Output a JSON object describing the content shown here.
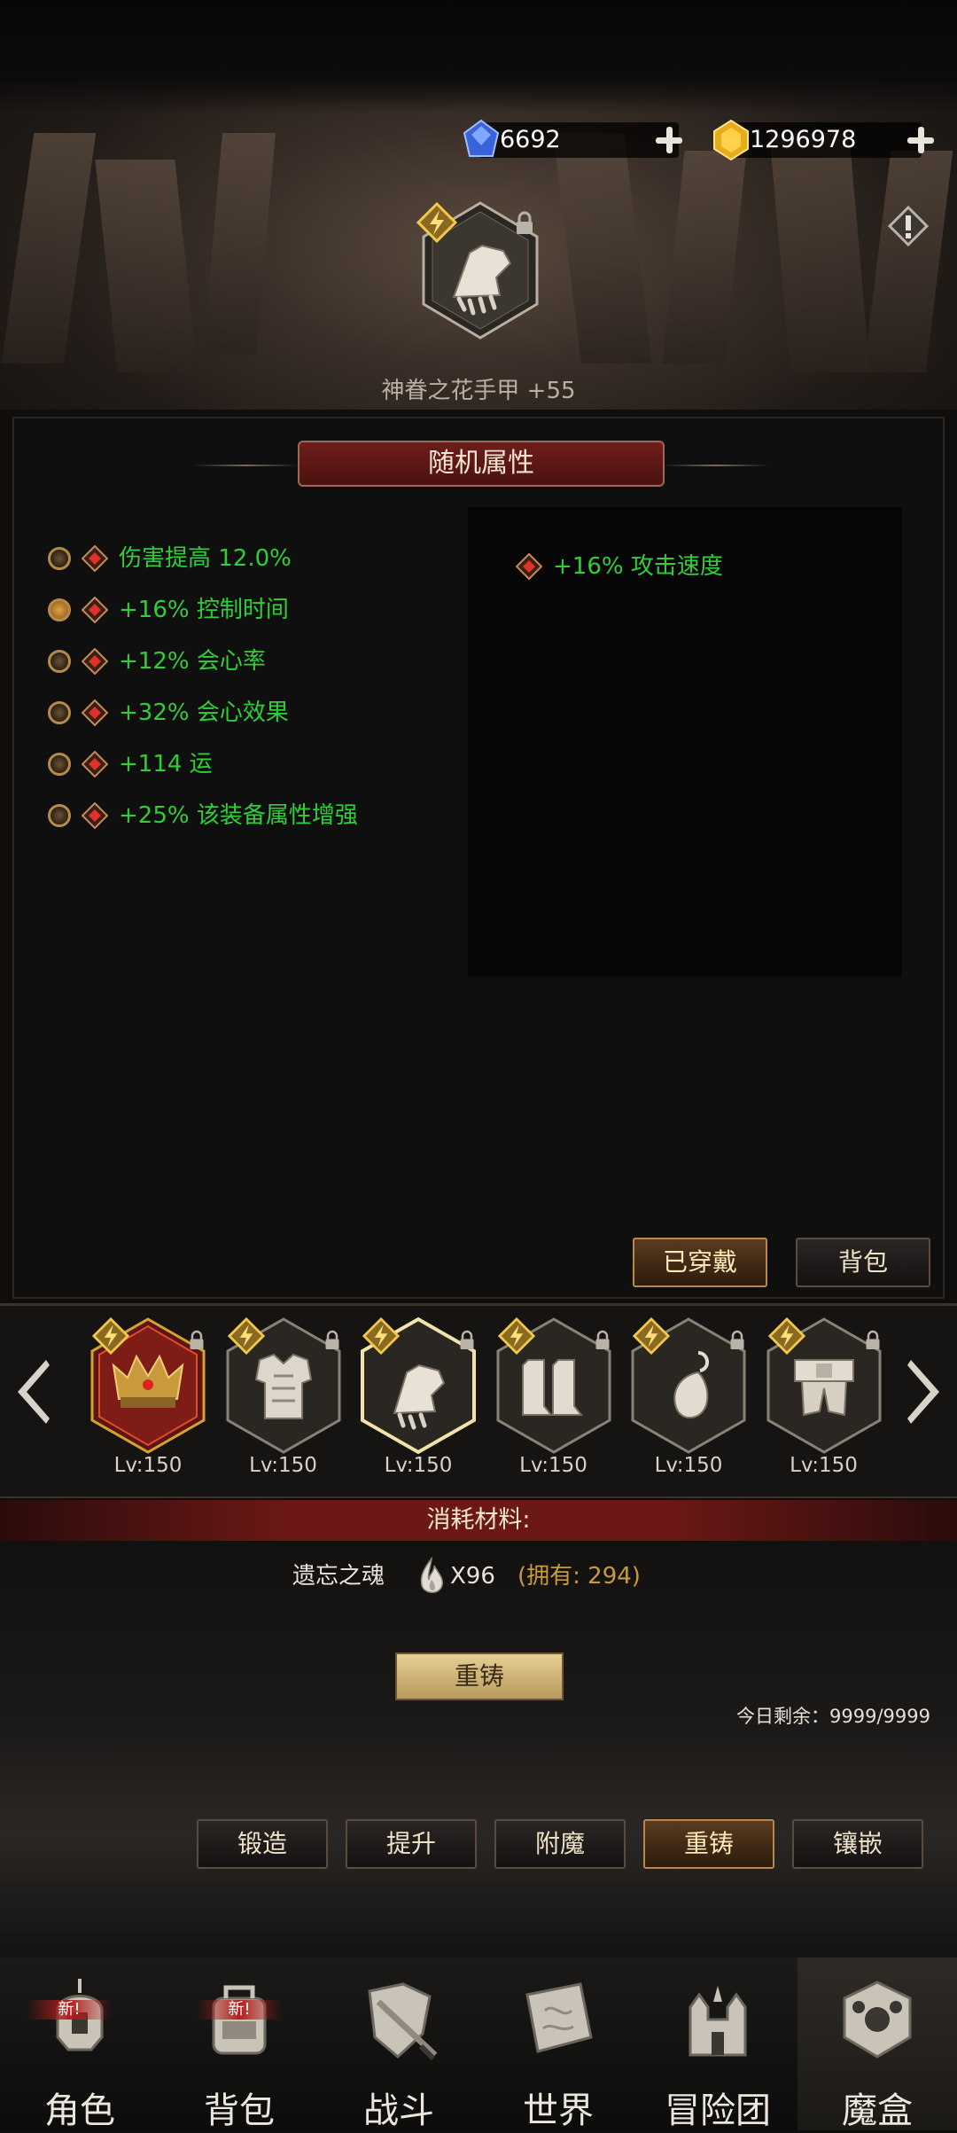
{
  "currency": {
    "gems": "6692",
    "gold": "1296978"
  },
  "item": {
    "name": "神眷之花手甲 +55"
  },
  "panel": {
    "title": "随机属性",
    "attributes": [
      {
        "text": "伤害提高 12.0%",
        "selected": false
      },
      {
        "text": "+16% 控制时间",
        "selected": true
      },
      {
        "text": "+12% 会心率",
        "selected": false
      },
      {
        "text": "+32% 会心效果",
        "selected": false
      },
      {
        "text": "+114 运",
        "selected": false
      },
      {
        "text": "+25% 该装备属性增强",
        "selected": false
      }
    ],
    "new_attribute": "+16% 攻击速度",
    "equipped_button": "已穿戴",
    "bag_button": "背包"
  },
  "equipment": [
    {
      "icon": "crown-icon",
      "level": "Lv:150"
    },
    {
      "icon": "armor-icon",
      "level": "Lv:150"
    },
    {
      "icon": "gauntlet-icon",
      "level": "Lv:150"
    },
    {
      "icon": "boots-icon",
      "level": "Lv:150"
    },
    {
      "icon": "earring-icon",
      "level": "Lv:150"
    },
    {
      "icon": "belt-icon",
      "level": "Lv:150"
    }
  ],
  "cost": {
    "title": "消耗材料:",
    "material": "遗忘之魂",
    "quantity": "X96",
    "owned": "(拥有: 294)"
  },
  "recast_button": "重铸",
  "remaining_today": "今日剩余：9999/9999",
  "tabs": [
    "锻造",
    "提升",
    "附魔",
    "重铸",
    "镶嵌"
  ],
  "nav": {
    "items": [
      "角色",
      "背包",
      "战斗",
      "世界",
      "冒险团",
      "魔盒"
    ],
    "new_badge": "新!"
  },
  "colors": {
    "attribute_green": "#2fcf38",
    "owned_gold": "#c79a3c",
    "banner_red": "#6e1e1b"
  }
}
